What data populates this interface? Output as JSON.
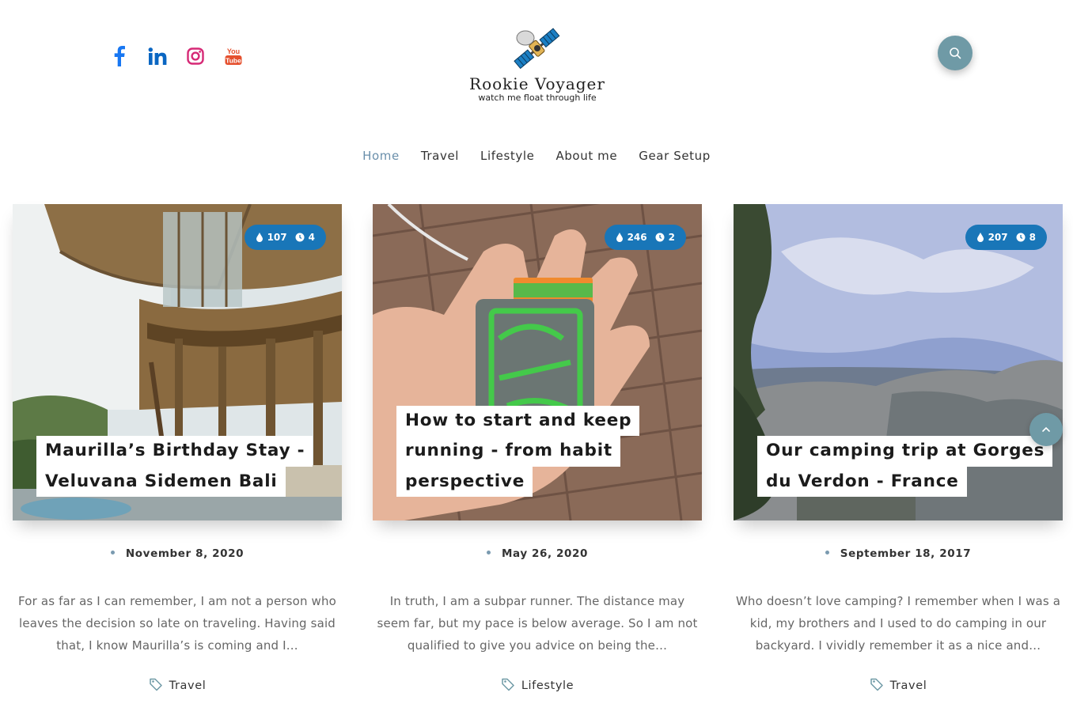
{
  "site": {
    "name": "Rookie Voyager",
    "tagline": "watch me float through life"
  },
  "social": [
    "facebook-icon",
    "linkedin-icon",
    "instagram-icon",
    "youtube-icon"
  ],
  "youtube_label_top": "You",
  "youtube_label_bottom": "Tube",
  "nav": {
    "items": [
      {
        "label": "Home",
        "active": true
      },
      {
        "label": "Travel",
        "active": false
      },
      {
        "label": "Lifestyle",
        "active": false
      },
      {
        "label": "About me",
        "active": false
      },
      {
        "label": "Gear Setup",
        "active": false
      }
    ]
  },
  "posts": [
    {
      "views": "107",
      "read_time": "4",
      "title_lines": [
        "Maurilla’s Birthday Stay -",
        "Veluvana Sidemen Bali"
      ],
      "date": "November 8, 2020",
      "excerpt": "For as far as I can remember, I am not a person who leaves the decision so late on traveling. Having said that, I know Maurilla’s is coming and I…",
      "category": "Travel"
    },
    {
      "views": "246",
      "read_time": "2",
      "title_lines": [
        "How to start and keep",
        "running - from habit",
        "perspective"
      ],
      "date": "May 26, 2020",
      "excerpt": "In truth, I am a subpar runner. The distance may seem far, but my pace is below average. So I am not qualified to give you advice on being the…",
      "category": "Lifestyle"
    },
    {
      "views": "207",
      "read_time": "8",
      "title_lines": [
        "Our camping trip at Gorges",
        "du Verdon - France"
      ],
      "date": "September 18, 2017",
      "excerpt": "Who doesn’t love camping? I remember when I was a kid, my brothers and I used to do camping in our backyard. I vividly remember it as a nice and…",
      "category": "Travel"
    }
  ],
  "colors": {
    "accent": "#6f9aa6",
    "badge": "#1976b8",
    "nav_active": "#6a8fab",
    "facebook": "#1877f2",
    "linkedin": "#0a66c2",
    "instagram": "#e1306c",
    "youtube": "#e5502e"
  }
}
